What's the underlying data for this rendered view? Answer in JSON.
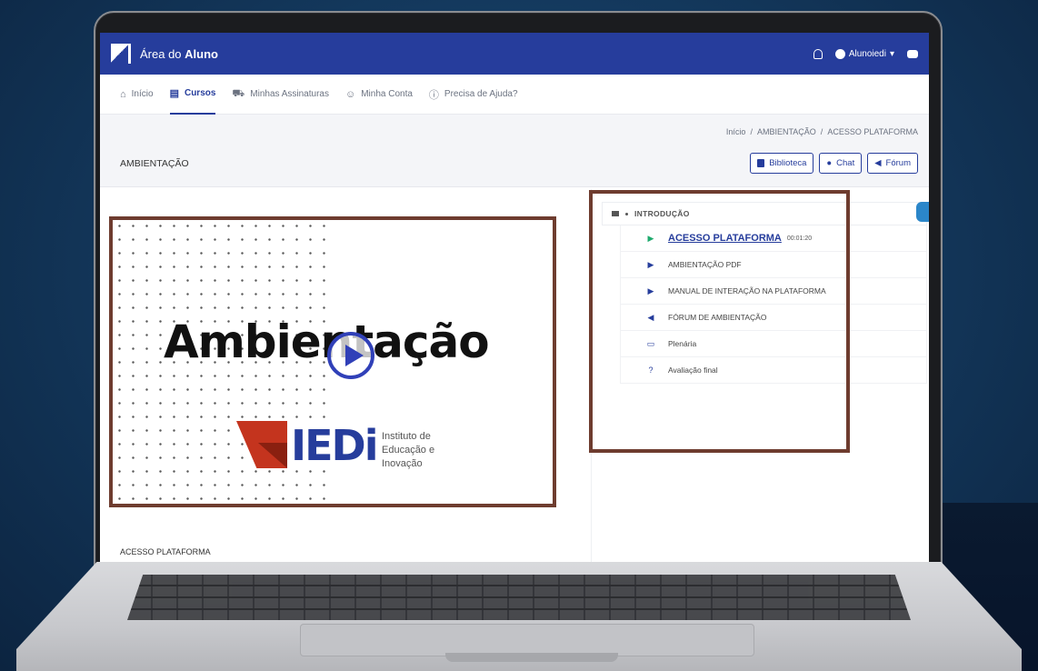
{
  "header": {
    "brand_prefix": "Área do",
    "brand_bold": "Aluno",
    "user_label": "Alunoiedi"
  },
  "nav": {
    "items": [
      {
        "label": "Início",
        "icon": "home-icon"
      },
      {
        "label": "Cursos",
        "icon": "book-icon",
        "active": true
      },
      {
        "label": "Minhas Assinaturas",
        "icon": "cart-icon"
      },
      {
        "label": "Minha Conta",
        "icon": "user-icon"
      },
      {
        "label": "Precisa de Ajuda?",
        "icon": "help-icon"
      }
    ]
  },
  "breadcrumb": {
    "items": [
      "Início",
      "AMBIENTAÇÃO",
      "ACESSO PLATAFORMA"
    ],
    "separator": "/"
  },
  "page": {
    "title": "AMBIENTAÇÃO",
    "buttons": {
      "library": "Biblioteca",
      "chat": "Chat",
      "forum": "Fórum"
    }
  },
  "video": {
    "headline": "Ambientação",
    "brand": "IEDi",
    "brand_sub": "Instituto de Educação e Inovação"
  },
  "lesson_title": "ACESSO PLATAFORMA",
  "course": {
    "section": "INTRODUÇÃO",
    "lessons": [
      {
        "label": "ACESSO PLATAFORMA",
        "duration": "00:01:20",
        "icon": "play-icon",
        "active": true
      },
      {
        "label": "AMBIENTAÇÃO PDF",
        "icon": "play-icon"
      },
      {
        "label": "MANUAL DE INTERAÇÃO NA PLATAFORMA",
        "icon": "play-icon"
      },
      {
        "label": "FÓRUM DE AMBIENTAÇÃO",
        "icon": "megaphone-icon"
      },
      {
        "label": "Plenária",
        "icon": "monitor-icon"
      },
      {
        "label": "Avaliação final",
        "icon": "question-icon"
      }
    ]
  },
  "colors": {
    "primary": "#263d9c",
    "active_play": "#1eaa6d",
    "annotation": "#6e3c2f",
    "iedi_red": "#c4341e"
  }
}
